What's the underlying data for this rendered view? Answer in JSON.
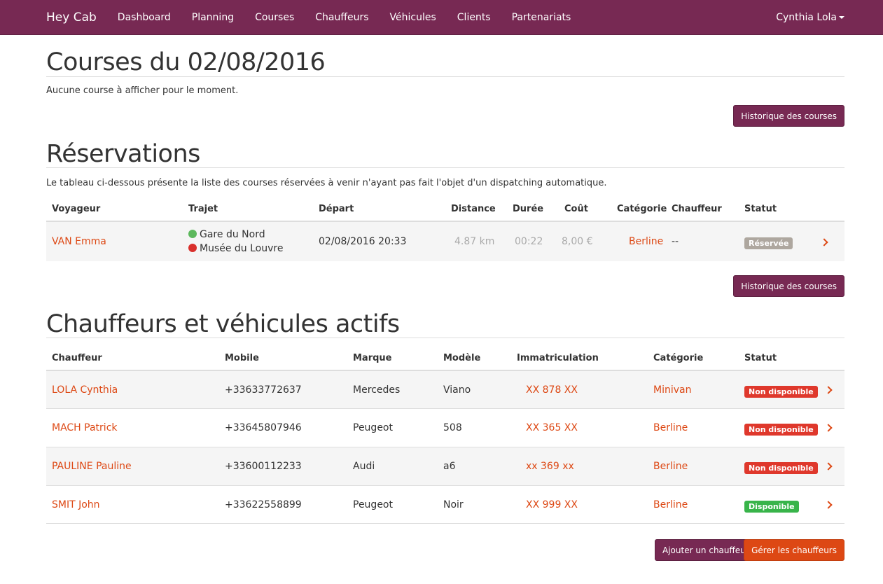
{
  "navbar": {
    "brand": "Hey Cab",
    "items": [
      "Dashboard",
      "Planning",
      "Courses",
      "Chauffeurs",
      "Véhicules",
      "Clients",
      "Partenariats"
    ],
    "user": "Cynthia Lola"
  },
  "courses": {
    "title": "Courses du 02/08/2016",
    "empty_text": "Aucune course à afficher pour le moment.",
    "history_button": "Historique des courses"
  },
  "reservations": {
    "title": "Réservations",
    "description": "Le tableau ci-dessous présente la liste des courses réservées à venir n'ayant pas fait l'objet d'un dispatching automatique.",
    "headers": [
      "Voyageur",
      "Trajet",
      "Départ",
      "Distance",
      "Durée",
      "Coût",
      "Catégorie",
      "Chauffeur",
      "Statut"
    ],
    "rows": [
      {
        "voyageur": "VAN Emma",
        "from": "Gare du Nord",
        "to": "Musée du Louvre",
        "depart": "02/08/2016 20:33",
        "distance": "4.87 km",
        "duree": "00:22",
        "cout": "8,00 €",
        "categorie": "Berline",
        "chauffeur": "--",
        "statut": "Réservée"
      }
    ],
    "history_button": "Historique des courses"
  },
  "drivers": {
    "title": "Chauffeurs et véhicules actifs",
    "headers": [
      "Chauffeur",
      "Mobile",
      "Marque",
      "Modèle",
      "Immatriculation",
      "Catégorie",
      "Statut"
    ],
    "rows": [
      {
        "name": "LOLA Cynthia",
        "mobile": "+33633772637",
        "marque": "Mercedes",
        "modele": "Viano",
        "immat": "XX 878 XX",
        "categorie": "Minivan",
        "statut": "Non disponible",
        "status_color": "#df382c"
      },
      {
        "name": "MACH Patrick",
        "mobile": "+33645807946",
        "marque": "Peugeot",
        "modele": "508",
        "immat": "XX 365 XX",
        "categorie": "Berline",
        "statut": "Non disponible",
        "status_color": "#df382c"
      },
      {
        "name": "PAULINE Pauline",
        "mobile": "+33600112233",
        "marque": "Audi",
        "modele": "a6",
        "immat": "xx 369 xx",
        "categorie": "Berline",
        "statut": "Non disponible",
        "status_color": "#df382c"
      },
      {
        "name": "SMIT John",
        "mobile": "+33622558899",
        "marque": "Peugeot",
        "modele": "Noir",
        "immat": "XX 999 XX",
        "categorie": "Berline",
        "statut": "Disponible",
        "status_color": "#38b44a"
      }
    ],
    "add_button": "Ajouter un chauffeur",
    "manage_button": "Gérer les chauffeurs"
  },
  "colors": {
    "primary": "#772953",
    "accent": "#dd4814",
    "danger": "#df382c",
    "success": "#38b44a",
    "muted_label": "#aea79f"
  }
}
